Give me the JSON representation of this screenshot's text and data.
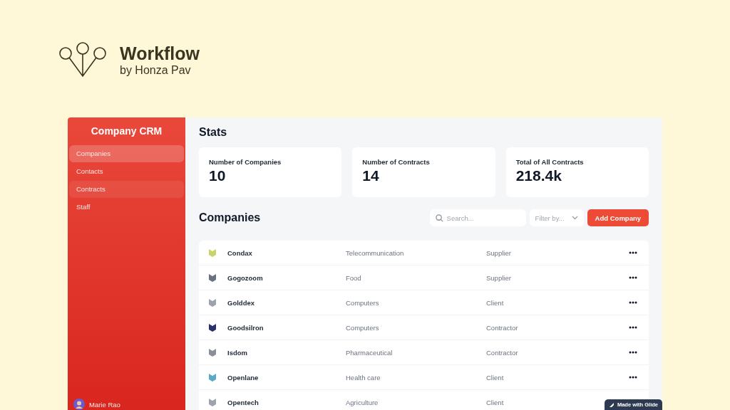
{
  "brand": {
    "title": "Workflow",
    "byline": "by Honza Pav"
  },
  "app": {
    "title": "Company CRM",
    "nav": [
      {
        "label": "Companies",
        "selected": true,
        "hovered": false
      },
      {
        "label": "Contacts",
        "selected": false,
        "hovered": false
      },
      {
        "label": "Contracts",
        "selected": false,
        "hovered": true
      },
      {
        "label": "Staff",
        "selected": false,
        "hovered": false
      }
    ],
    "user": {
      "name": "Marie Rao"
    },
    "stats_title": "Stats",
    "stats": [
      {
        "label": "Number of Companies",
        "value": "10"
      },
      {
        "label": "Number of Contracts",
        "value": "14"
      },
      {
        "label": "Total of All Contracts",
        "value": "218.4k"
      }
    ],
    "companies_title": "Companies",
    "search": {
      "placeholder": "Search..."
    },
    "filter": {
      "placeholder": "Filter by..."
    },
    "add_button": "Add Company",
    "rows": [
      {
        "name": "Condax",
        "industry": "Telecommunication",
        "type": "Supplier",
        "color": "#c8d46a"
      },
      {
        "name": "Gogozoom",
        "industry": "Food",
        "type": "Supplier",
        "color": "#6b7280"
      },
      {
        "name": "Golddex",
        "industry": "Computers",
        "type": "Client",
        "color": "#9ca3af"
      },
      {
        "name": "Goodsilron",
        "industry": "Computers",
        "type": "Contractor",
        "color": "#2b2f6b"
      },
      {
        "name": "Isdom",
        "industry": "Pharmaceutical",
        "type": "Contractor",
        "color": "#8a8f99"
      },
      {
        "name": "Openlane",
        "industry": "Health care",
        "type": "Client",
        "color": "#5aa9c9"
      },
      {
        "name": "Opentech",
        "industry": "Agriculture",
        "type": "Client",
        "color": "#9ca3af"
      }
    ],
    "badge": "Made with Glide"
  }
}
